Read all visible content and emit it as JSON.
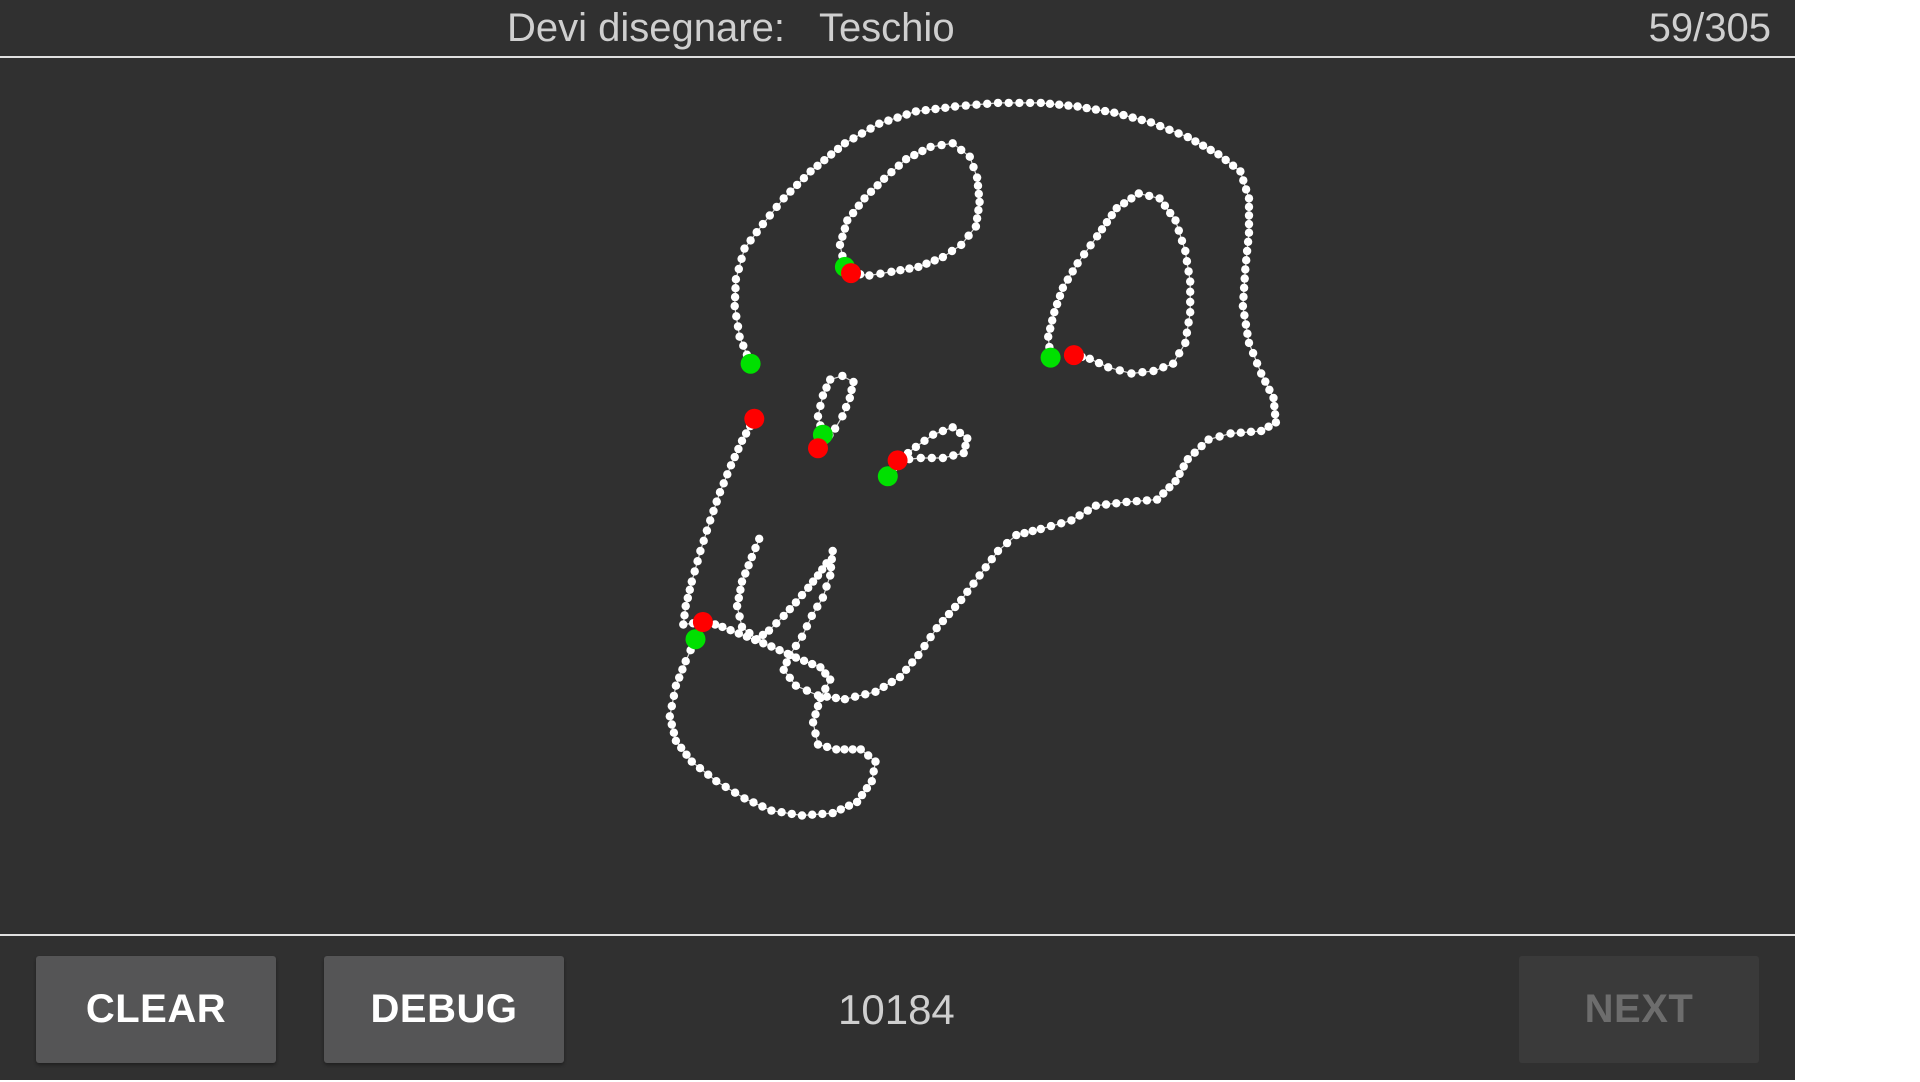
{
  "header": {
    "prompt_label": "Devi disegnare:",
    "target_word": "Teschio",
    "progress": "59/305"
  },
  "footer": {
    "clear_label": "CLEAR",
    "debug_label": "DEBUG",
    "score": "10184",
    "next_label": "NEXT"
  },
  "colors": {
    "background": "#303030",
    "stroke_point": "#ffffff",
    "stroke_start": "#00e000",
    "stroke_end": "#ff0000",
    "button": "#555556",
    "button_disabled": "#3a3a3a"
  }
}
